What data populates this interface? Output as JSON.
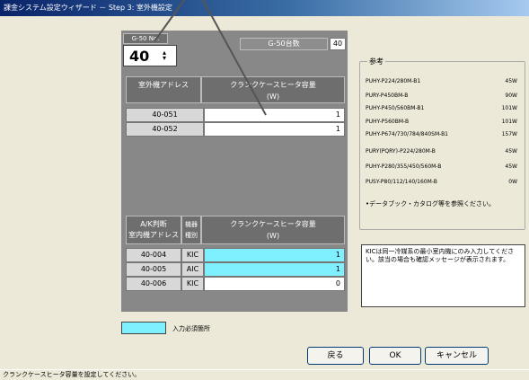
{
  "window": {
    "title": "課金システム設定ウィザード － Step 3: 室外機設定"
  },
  "group": {
    "no_label": "G-50 No.",
    "no_value": "40",
    "count_label": "G-50台数",
    "count_value": "40"
  },
  "table1": {
    "col1": "室外機アドレス",
    "col2a": "クランクケースヒータ容量",
    "col2b": "(W)",
    "rows": [
      {
        "addr": "40-051",
        "val": "1"
      },
      {
        "addr": "40-052",
        "val": "1"
      }
    ]
  },
  "table2": {
    "col1a": "A/K判断",
    "col1b": "室内機アドレス",
    "col2a": "機器",
    "col2b": "種別",
    "col3a": "クランクケースヒータ容量",
    "col3b": "(W)",
    "rows": [
      {
        "addr": "40-004",
        "type": "KIC",
        "val": "1",
        "required": true
      },
      {
        "addr": "40-005",
        "type": "AIC",
        "val": "1",
        "required": true
      },
      {
        "addr": "40-006",
        "type": "KIC",
        "val": "0",
        "required": false
      }
    ]
  },
  "reference": {
    "title": "参考",
    "items": [
      {
        "model": "PUHY-P224/280M-B1",
        "watt": "45W"
      },
      {
        "model": "PURY-P450BM-B",
        "watt": "90W"
      },
      {
        "model": "PUHY-P450/560BM-B1",
        "watt": "101W"
      },
      {
        "model": "PUHY-P560BM-B",
        "watt": "101W"
      },
      {
        "model": "PUHY-P674/730/784/840SM-B1",
        "watt": "157W"
      },
      {
        "model": "PURY(PQRY)-P224/280M-B",
        "watt": "45W"
      },
      {
        "model": "PUHY-P280/355/450/560M-B",
        "watt": "45W"
      },
      {
        "model": "PUSY-P80/112/140/160M-B",
        "watt": "0W"
      }
    ],
    "footnote": "•データブック・カタログ等を参照ください。"
  },
  "kic_note": "KICは同一冷媒系の最小室内機にのみ入力してください。該当の場合も確認メッセージが表示されます。",
  "legend": {
    "label": "入力必須箇所",
    "color": "#7ff0ff"
  },
  "buttons": {
    "back": "戻る",
    "ok": "OK",
    "cancel": "キャンセル"
  },
  "status": "クランクケースヒータ容量を設定してください。"
}
